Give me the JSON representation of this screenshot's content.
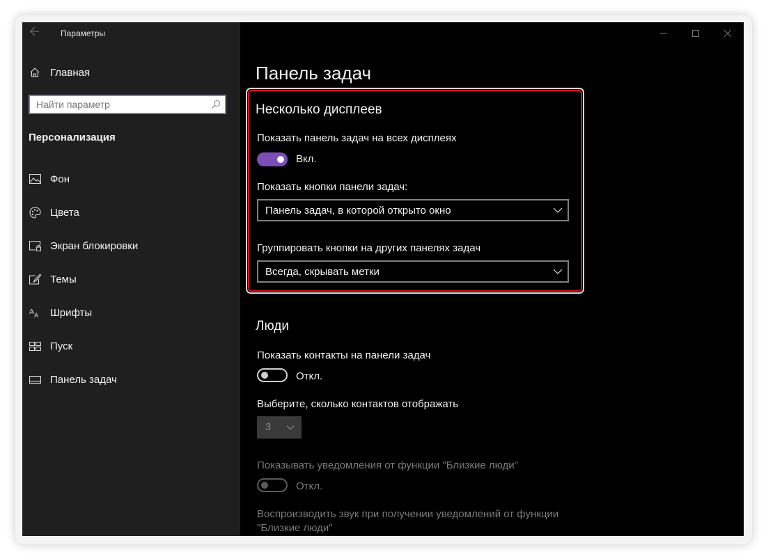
{
  "window": {
    "title": "Параметры"
  },
  "sidebar": {
    "home_label": "Главная",
    "search_placeholder": "Найти параметр",
    "section_title": "Персонализация",
    "items": [
      {
        "label": "Фон",
        "icon": "picture-icon"
      },
      {
        "label": "Цвета",
        "icon": "palette-icon"
      },
      {
        "label": "Экран блокировки",
        "icon": "lock-screen-icon"
      },
      {
        "label": "Темы",
        "icon": "themes-icon"
      },
      {
        "label": "Шрифты",
        "icon": "fonts-icon"
      },
      {
        "label": "Пуск",
        "icon": "start-icon"
      },
      {
        "label": "Панель задач",
        "icon": "taskbar-icon"
      }
    ]
  },
  "content": {
    "page_title": "Панель задач",
    "multi_display": {
      "title": "Несколько дисплеев",
      "show_taskbar_label": "Показать панель задач на всех дисплеях",
      "show_taskbar_toggle": "Вкл.",
      "show_buttons_label": "Показать кнопки панели задач:",
      "show_buttons_value": "Панель задач, в которой открыто окно",
      "combine_label": "Группировать кнопки на других панелях задач",
      "combine_value": "Всегда, скрывать метки"
    },
    "people": {
      "title": "Люди",
      "show_contacts_label": "Показать контакты на панели задач",
      "show_contacts_toggle": "Откл.",
      "count_label": "Выберите, сколько контактов отображать",
      "count_value": "3",
      "notifications_label": "Показывать уведомления от функции \"Близкие люди\"",
      "notifications_toggle": "Откл.",
      "sound_label_line1": "Воспроизводить звук при получении уведомлений от функции",
      "sound_label_line2": "\"Близкие люди\""
    }
  },
  "colors": {
    "accent": "#7b4db8",
    "highlight": "#e0101a",
    "sidebar_bg": "#1f1f1f",
    "content_bg": "#000000"
  }
}
